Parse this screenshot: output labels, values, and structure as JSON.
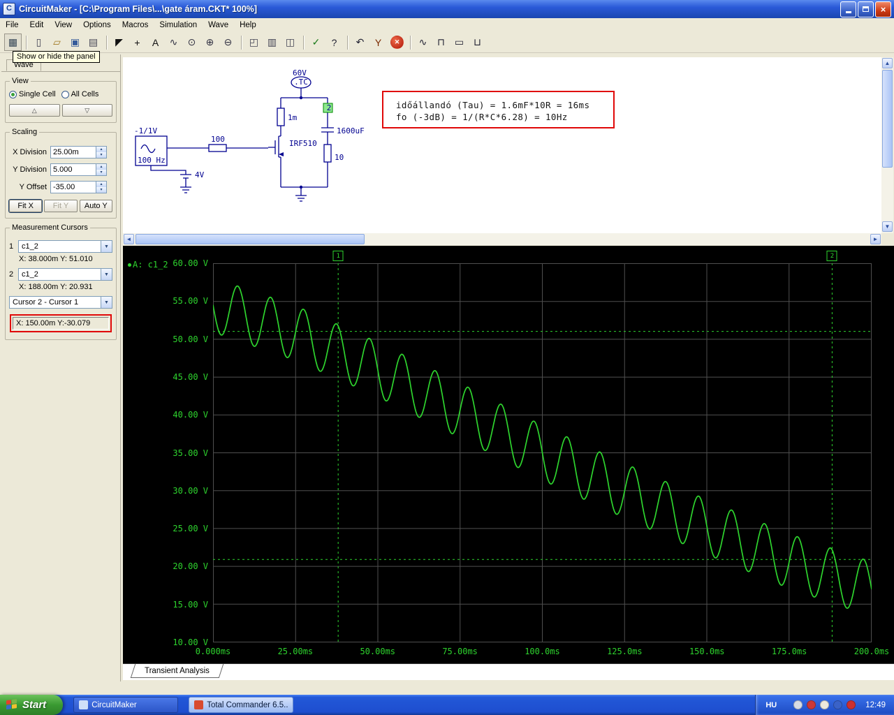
{
  "window": {
    "title": "CircuitMaker - [C:\\Program Files\\...\\gate áram.CKT* 100%]",
    "menus": [
      "File",
      "Edit",
      "View",
      "Options",
      "Macros",
      "Simulation",
      "Wave",
      "Help"
    ],
    "tooltip": "Show or hide the panel"
  },
  "toolbar": [
    {
      "name": "toggle-panel-button",
      "glyph": "▦",
      "color": "#334455",
      "sep_after": true
    },
    {
      "name": "new-file-button",
      "glyph": "▯",
      "color": "#444455"
    },
    {
      "name": "open-file-button",
      "glyph": "▱",
      "color": "#a07820"
    },
    {
      "name": "save-button",
      "glyph": "▣",
      "color": "#345a9a"
    },
    {
      "name": "print-button",
      "glyph": "▤",
      "color": "#444455",
      "sep_after": true
    },
    {
      "name": "select-tool-button",
      "glyph": "◤",
      "color": "#111111"
    },
    {
      "name": "add-part-button",
      "glyph": "+",
      "color": "#111111"
    },
    {
      "name": "text-tool-button",
      "glyph": "A",
      "color": "#111111"
    },
    {
      "name": "wire-tool-button",
      "glyph": "∿",
      "color": "#333344"
    },
    {
      "name": "zoom-tool-button",
      "glyph": "⊙",
      "color": "#333344"
    },
    {
      "name": "zoom-in-button",
      "glyph": "⊕",
      "color": "#333344"
    },
    {
      "name": "zoom-out-button",
      "glyph": "⊖",
      "color": "#333344",
      "sep_after": true
    },
    {
      "name": "zoom-page-button",
      "glyph": "◰",
      "color": "#444455"
    },
    {
      "name": "pages-button",
      "glyph": "▥",
      "color": "#444455"
    },
    {
      "name": "split-pane-button",
      "glyph": "◫",
      "color": "#444455",
      "sep_after": true
    },
    {
      "name": "check-button",
      "glyph": "✓",
      "color": "#1a7a1a"
    },
    {
      "name": "help-button",
      "glyph": "?",
      "color": "#222233",
      "sep_after": true
    },
    {
      "name": "undo-button",
      "glyph": "↶",
      "color": "#222233"
    },
    {
      "name": "probe-tool-button",
      "glyph": "Y",
      "color": "#7a2a00"
    },
    {
      "name": "stop-simulation-button",
      "glyph": "✕",
      "variant": "stop",
      "color": "#ffffff",
      "sep_after": true
    },
    {
      "name": "waveforms-button",
      "glyph": "∿",
      "color": "#222233"
    },
    {
      "name": "digital-scope-button",
      "glyph": "⊓",
      "color": "#222233"
    },
    {
      "name": "analog-scope-button",
      "glyph": "▭",
      "color": "#222233"
    },
    {
      "name": "mixed-scope-button",
      "glyph": "⊔",
      "color": "#222233"
    }
  ],
  "panel": {
    "tab": "Wave",
    "view": {
      "label": "View",
      "single_cell": "Single Cell",
      "all_cells": "All Cells",
      "up_glyph": "△",
      "down_glyph": "▽"
    },
    "scaling": {
      "label": "Scaling",
      "x_division_label": "X Division",
      "x_division": "25.00m",
      "y_division_label": "Y Division",
      "y_division": "5.000",
      "y_offset_label": "Y Offset",
      "y_offset": "-35.00",
      "fit_x": "Fit X",
      "fit_y": "Fit Y",
      "auto_y": "Auto Y"
    },
    "cursors": {
      "label": "Measurement Cursors",
      "c1_index": "1",
      "c1_value": "c1_2",
      "c1_readout": "X: 38.000m Y: 51.010",
      "c2_index": "2",
      "c2_value": "c1_2",
      "c2_readout": "X: 188.00m Y: 20.931",
      "diff_select": "Cursor 2 - Cursor 1",
      "diff_readout": "X: 150.00m Y:-30.079"
    }
  },
  "schematic": {
    "annotation_line1": "időállandó (Tau) = 1.6mF*10R = 16ms",
    "annotation_line2": "fo (-3dB) = 1/(R*C*6.28) = 10Hz",
    "annotation_border_color": "#e00808",
    "labels": {
      "supply_voltage": "60V",
      "supply_name": ".TC",
      "drain_resistor": "1m",
      "mosfet": "IRF510",
      "capacitor": "1600uF",
      "load_resistor": "10",
      "gate_resistor": "100",
      "source_amplitude": "-1/1V",
      "source_frequency": "100 Hz",
      "bias_battery": "4V",
      "probe_number": "2"
    }
  },
  "chart_data": {
    "type": "line",
    "trace_label": "A: c1_2",
    "xlim_ms": [
      0,
      200
    ],
    "ylim_v": [
      10,
      60
    ],
    "x_ticks": [
      "0.000ms",
      "25.00ms",
      "50.00ms",
      "75.00ms",
      "100.0ms",
      "125.0ms",
      "150.0ms",
      "175.0ms",
      "200.0ms"
    ],
    "y_ticks": [
      "60.00 V",
      "55.00 V",
      "50.00 V",
      "45.00 V",
      "40.00 V",
      "35.00 V",
      "30.00 V",
      "25.00 V",
      "20.00 V",
      "15.00 V",
      "10.00 V"
    ],
    "grid": true,
    "background": "#000000",
    "trace_color": "#2ed42e",
    "grid_color": "#4f4f4f",
    "signal": {
      "description": "100 Hz sinusoid riding on a slowly decaying DC level",
      "freq_hz": 100,
      "ripple_amplitude_v": 3.6,
      "mean_anchor_ms_v": [
        [
          0,
          54.5
        ],
        [
          25,
          50.8
        ],
        [
          50,
          46.0
        ],
        [
          75,
          40.6
        ],
        [
          100,
          35.0
        ],
        [
          125,
          30.0
        ],
        [
          150,
          25.2
        ],
        [
          175,
          20.7
        ],
        [
          200,
          17.0
        ]
      ]
    },
    "cursors": [
      {
        "id": "1",
        "x_ms": 38.0,
        "y_v": 51.01
      },
      {
        "id": "2",
        "x_ms": 188.0,
        "y_v": 20.931
      }
    ]
  },
  "tabs": {
    "transient": "Transient Analysis"
  },
  "taskbar": {
    "start_label": "Start",
    "tasks": [
      {
        "label": "CircuitMaker",
        "active": false,
        "icon_color": "#cfe0f8"
      },
      {
        "label": "Total Commander 6.5...",
        "active": true,
        "icon_color": "#d84a30"
      }
    ],
    "language_indicator": "HU",
    "clock": "12:49",
    "tray_icons": [
      {
        "name": "tray-icon-1",
        "color": "#d8dce4"
      },
      {
        "name": "tray-icon-2",
        "color": "#cc3838"
      },
      {
        "name": "tray-volume-icon",
        "color": "#ece8dc"
      },
      {
        "name": "tray-icon-3",
        "color": "#3a62c8"
      },
      {
        "name": "tray-icon-4",
        "color": "#cc3030"
      }
    ]
  }
}
